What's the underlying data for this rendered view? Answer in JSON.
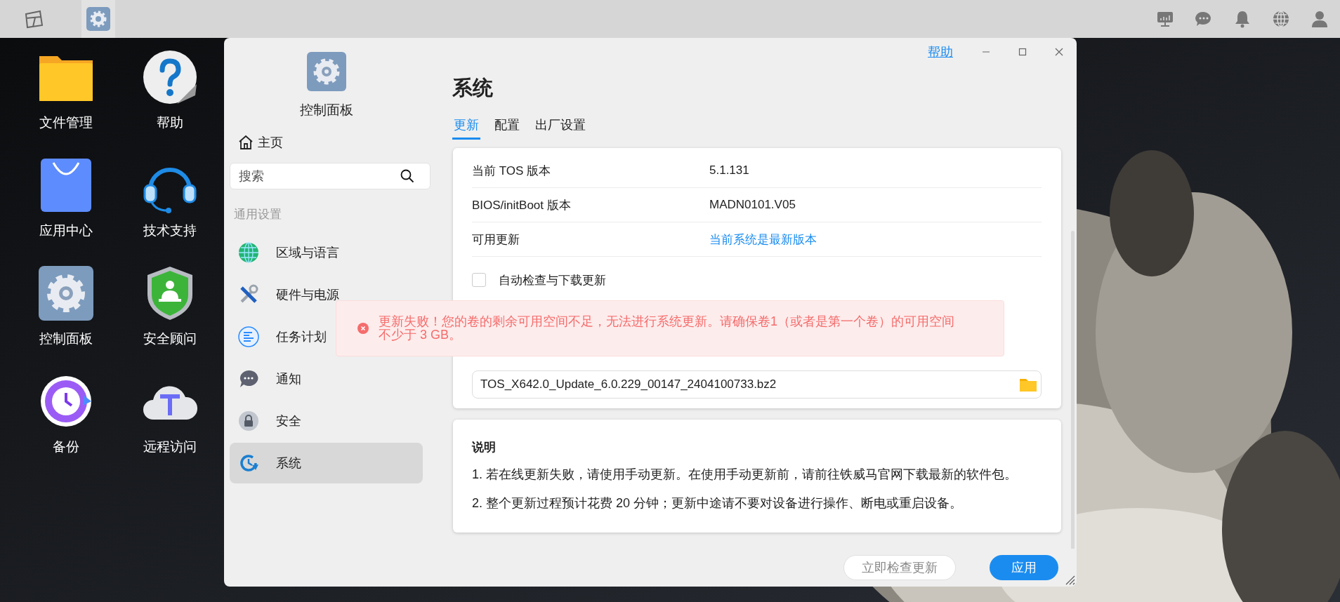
{
  "taskbar": {
    "apps": [
      {
        "kind": "desktop",
        "selected": false
      },
      {
        "kind": "control-panel",
        "selected": true
      }
    ]
  },
  "desktop_icons": [
    {
      "label": "文件管理",
      "kind": "folder"
    },
    {
      "label": "帮助",
      "kind": "help"
    },
    {
      "label": "应用中心",
      "kind": "store"
    },
    {
      "label": "技术支持",
      "kind": "headset"
    },
    {
      "label": "控制面板",
      "kind": "control-panel"
    },
    {
      "label": "安全顾问",
      "kind": "shield"
    },
    {
      "label": "备份",
      "kind": "backup"
    },
    {
      "label": "远程访问",
      "kind": "cloud"
    }
  ],
  "window": {
    "help_link": "帮助",
    "sidebar": {
      "title": "控制面板",
      "home": "主页",
      "search": {
        "placeholder": "搜索"
      },
      "section": "通用设置",
      "items": [
        {
          "label": "区域与语言",
          "kind": "globe",
          "selected": false
        },
        {
          "label": "硬件与电源",
          "kind": "tools",
          "selected": false
        },
        {
          "label": "任务计划",
          "kind": "tasks",
          "selected": false
        },
        {
          "label": "通知",
          "kind": "chat",
          "selected": false
        },
        {
          "label": "安全",
          "kind": "lock",
          "selected": false
        },
        {
          "label": "系统",
          "kind": "system",
          "selected": true
        }
      ]
    },
    "title": "系统",
    "tabs": [
      {
        "label": "更新",
        "selected": true
      },
      {
        "label": "配置",
        "selected": false
      },
      {
        "label": "出厂设置",
        "selected": false
      }
    ],
    "info_rows": [
      {
        "label": "当前 TOS 版本",
        "value": "5.1.131",
        "kind": "text"
      },
      {
        "label": "BIOS/initBoot 版本",
        "value": "MADN0101.V05",
        "kind": "text"
      },
      {
        "label": "可用更新",
        "value": "当前系统是最新版本",
        "kind": "link"
      }
    ],
    "auto_update": {
      "label": "自动检查与下载更新",
      "checked": false
    },
    "file_field": {
      "value": "TOS_X642.0_Update_6.0.229_00147_2404100733.bz2"
    },
    "notes": {
      "title": "说明",
      "items": [
        "1. 若在线更新失败，请使用手动更新。在使用手动更新前，请前往铁威马官网下载最新的软件包。",
        "2. 整个更新过程预计花费 20 分钟；更新中途请不要对设备进行操作、断电或重启设备。"
      ]
    },
    "buttons": [
      {
        "label": "立即检查更新",
        "kind": "secondary"
      },
      {
        "label": "应用",
        "kind": "primary"
      }
    ]
  },
  "toast": {
    "kind": "error",
    "message": "更新失败！您的卷的剩余可用空间不足，无法进行系统更新。请确保卷1（或者是第一个卷）的可用空间不少于 3 GB。"
  }
}
